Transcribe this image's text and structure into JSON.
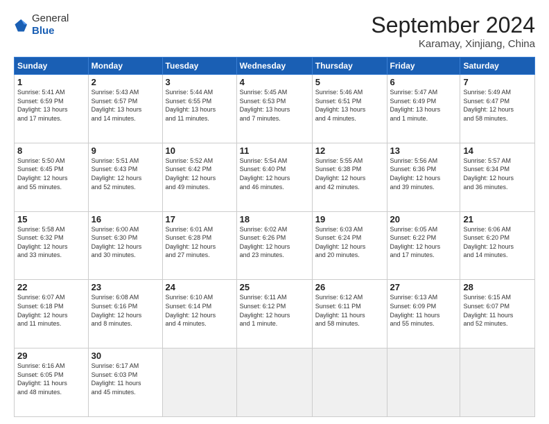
{
  "header": {
    "logo_general": "General",
    "logo_blue": "Blue",
    "month_title": "September 2024",
    "location": "Karamay, Xinjiang, China"
  },
  "weekdays": [
    "Sunday",
    "Monday",
    "Tuesday",
    "Wednesday",
    "Thursday",
    "Friday",
    "Saturday"
  ],
  "weeks": [
    [
      {
        "day": 1,
        "info": "Sunrise: 5:41 AM\nSunset: 6:59 PM\nDaylight: 13 hours\nand 17 minutes."
      },
      {
        "day": 2,
        "info": "Sunrise: 5:43 AM\nSunset: 6:57 PM\nDaylight: 13 hours\nand 14 minutes."
      },
      {
        "day": 3,
        "info": "Sunrise: 5:44 AM\nSunset: 6:55 PM\nDaylight: 13 hours\nand 11 minutes."
      },
      {
        "day": 4,
        "info": "Sunrise: 5:45 AM\nSunset: 6:53 PM\nDaylight: 13 hours\nand 7 minutes."
      },
      {
        "day": 5,
        "info": "Sunrise: 5:46 AM\nSunset: 6:51 PM\nDaylight: 13 hours\nand 4 minutes."
      },
      {
        "day": 6,
        "info": "Sunrise: 5:47 AM\nSunset: 6:49 PM\nDaylight: 13 hours\nand 1 minute."
      },
      {
        "day": 7,
        "info": "Sunrise: 5:49 AM\nSunset: 6:47 PM\nDaylight: 12 hours\nand 58 minutes."
      }
    ],
    [
      {
        "day": 8,
        "info": "Sunrise: 5:50 AM\nSunset: 6:45 PM\nDaylight: 12 hours\nand 55 minutes."
      },
      {
        "day": 9,
        "info": "Sunrise: 5:51 AM\nSunset: 6:43 PM\nDaylight: 12 hours\nand 52 minutes."
      },
      {
        "day": 10,
        "info": "Sunrise: 5:52 AM\nSunset: 6:42 PM\nDaylight: 12 hours\nand 49 minutes."
      },
      {
        "day": 11,
        "info": "Sunrise: 5:54 AM\nSunset: 6:40 PM\nDaylight: 12 hours\nand 46 minutes."
      },
      {
        "day": 12,
        "info": "Sunrise: 5:55 AM\nSunset: 6:38 PM\nDaylight: 12 hours\nand 42 minutes."
      },
      {
        "day": 13,
        "info": "Sunrise: 5:56 AM\nSunset: 6:36 PM\nDaylight: 12 hours\nand 39 minutes."
      },
      {
        "day": 14,
        "info": "Sunrise: 5:57 AM\nSunset: 6:34 PM\nDaylight: 12 hours\nand 36 minutes."
      }
    ],
    [
      {
        "day": 15,
        "info": "Sunrise: 5:58 AM\nSunset: 6:32 PM\nDaylight: 12 hours\nand 33 minutes."
      },
      {
        "day": 16,
        "info": "Sunrise: 6:00 AM\nSunset: 6:30 PM\nDaylight: 12 hours\nand 30 minutes."
      },
      {
        "day": 17,
        "info": "Sunrise: 6:01 AM\nSunset: 6:28 PM\nDaylight: 12 hours\nand 27 minutes."
      },
      {
        "day": 18,
        "info": "Sunrise: 6:02 AM\nSunset: 6:26 PM\nDaylight: 12 hours\nand 23 minutes."
      },
      {
        "day": 19,
        "info": "Sunrise: 6:03 AM\nSunset: 6:24 PM\nDaylight: 12 hours\nand 20 minutes."
      },
      {
        "day": 20,
        "info": "Sunrise: 6:05 AM\nSunset: 6:22 PM\nDaylight: 12 hours\nand 17 minutes."
      },
      {
        "day": 21,
        "info": "Sunrise: 6:06 AM\nSunset: 6:20 PM\nDaylight: 12 hours\nand 14 minutes."
      }
    ],
    [
      {
        "day": 22,
        "info": "Sunrise: 6:07 AM\nSunset: 6:18 PM\nDaylight: 12 hours\nand 11 minutes."
      },
      {
        "day": 23,
        "info": "Sunrise: 6:08 AM\nSunset: 6:16 PM\nDaylight: 12 hours\nand 8 minutes."
      },
      {
        "day": 24,
        "info": "Sunrise: 6:10 AM\nSunset: 6:14 PM\nDaylight: 12 hours\nand 4 minutes."
      },
      {
        "day": 25,
        "info": "Sunrise: 6:11 AM\nSunset: 6:12 PM\nDaylight: 12 hours\nand 1 minute."
      },
      {
        "day": 26,
        "info": "Sunrise: 6:12 AM\nSunset: 6:11 PM\nDaylight: 11 hours\nand 58 minutes."
      },
      {
        "day": 27,
        "info": "Sunrise: 6:13 AM\nSunset: 6:09 PM\nDaylight: 11 hours\nand 55 minutes."
      },
      {
        "day": 28,
        "info": "Sunrise: 6:15 AM\nSunset: 6:07 PM\nDaylight: 11 hours\nand 52 minutes."
      }
    ],
    [
      {
        "day": 29,
        "info": "Sunrise: 6:16 AM\nSunset: 6:05 PM\nDaylight: 11 hours\nand 48 minutes."
      },
      {
        "day": 30,
        "info": "Sunrise: 6:17 AM\nSunset: 6:03 PM\nDaylight: 11 hours\nand 45 minutes."
      },
      {
        "day": null,
        "info": ""
      },
      {
        "day": null,
        "info": ""
      },
      {
        "day": null,
        "info": ""
      },
      {
        "day": null,
        "info": ""
      },
      {
        "day": null,
        "info": ""
      }
    ]
  ]
}
